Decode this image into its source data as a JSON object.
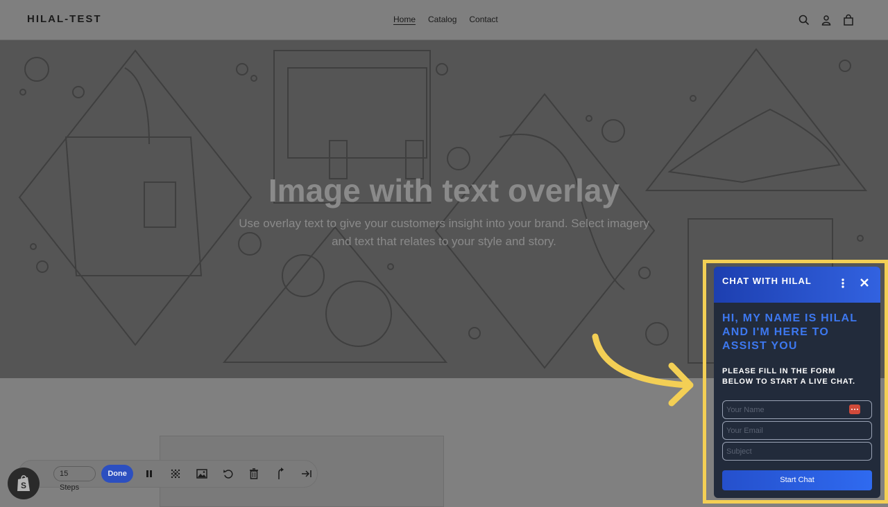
{
  "header": {
    "logo": "HILAL-TEST",
    "nav": [
      "Home",
      "Catalog",
      "Contact"
    ],
    "icons": [
      "search-icon",
      "account-icon",
      "cart-icon"
    ]
  },
  "hero": {
    "title": "Image with text overlay",
    "subtitle": "Use overlay text to give your customers insight into your brand. Select imagery and text that relates to your style and story."
  },
  "toolbar": {
    "steps_label": "15 Steps",
    "done_label": "Done",
    "icons": [
      "pause-icon",
      "blur-icon",
      "image-icon",
      "undo-icon",
      "trash-icon",
      "branch-icon",
      "skip-icon"
    ]
  },
  "chat": {
    "title": "CHAT WITH HILAL",
    "greeting": "HI, MY NAME IS HILAL AND I'M HERE TO ASSIST YOU",
    "instructions": "PLEASE FILL IN THE FORM BELOW TO START A LIVE CHAT.",
    "name_placeholder": "Your Name",
    "email_placeholder": "Your Email",
    "subject_placeholder": "Subject",
    "button_label": "Start Chat"
  },
  "colors": {
    "overlay_gray": "#555555",
    "chat_bg": "#222b3b",
    "accent_blue": "#3d78f0",
    "highlight_yellow": "#f3cf55",
    "done_blue": "#2c4fc0"
  }
}
